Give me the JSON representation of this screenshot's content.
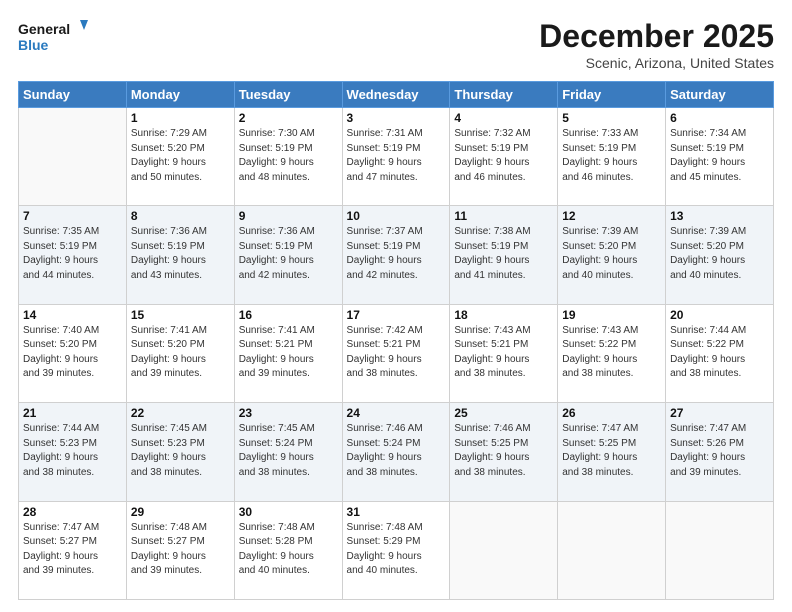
{
  "logo": {
    "line1": "General",
    "line2": "Blue"
  },
  "title": "December 2025",
  "location": "Scenic, Arizona, United States",
  "days_header": [
    "Sunday",
    "Monday",
    "Tuesday",
    "Wednesday",
    "Thursday",
    "Friday",
    "Saturday"
  ],
  "weeks": [
    [
      {
        "num": "",
        "info": ""
      },
      {
        "num": "1",
        "info": "Sunrise: 7:29 AM\nSunset: 5:20 PM\nDaylight: 9 hours\nand 50 minutes."
      },
      {
        "num": "2",
        "info": "Sunrise: 7:30 AM\nSunset: 5:19 PM\nDaylight: 9 hours\nand 48 minutes."
      },
      {
        "num": "3",
        "info": "Sunrise: 7:31 AM\nSunset: 5:19 PM\nDaylight: 9 hours\nand 47 minutes."
      },
      {
        "num": "4",
        "info": "Sunrise: 7:32 AM\nSunset: 5:19 PM\nDaylight: 9 hours\nand 46 minutes."
      },
      {
        "num": "5",
        "info": "Sunrise: 7:33 AM\nSunset: 5:19 PM\nDaylight: 9 hours\nand 46 minutes."
      },
      {
        "num": "6",
        "info": "Sunrise: 7:34 AM\nSunset: 5:19 PM\nDaylight: 9 hours\nand 45 minutes."
      }
    ],
    [
      {
        "num": "7",
        "info": "Sunrise: 7:35 AM\nSunset: 5:19 PM\nDaylight: 9 hours\nand 44 minutes."
      },
      {
        "num": "8",
        "info": "Sunrise: 7:36 AM\nSunset: 5:19 PM\nDaylight: 9 hours\nand 43 minutes."
      },
      {
        "num": "9",
        "info": "Sunrise: 7:36 AM\nSunset: 5:19 PM\nDaylight: 9 hours\nand 42 minutes."
      },
      {
        "num": "10",
        "info": "Sunrise: 7:37 AM\nSunset: 5:19 PM\nDaylight: 9 hours\nand 42 minutes."
      },
      {
        "num": "11",
        "info": "Sunrise: 7:38 AM\nSunset: 5:19 PM\nDaylight: 9 hours\nand 41 minutes."
      },
      {
        "num": "12",
        "info": "Sunrise: 7:39 AM\nSunset: 5:20 PM\nDaylight: 9 hours\nand 40 minutes."
      },
      {
        "num": "13",
        "info": "Sunrise: 7:39 AM\nSunset: 5:20 PM\nDaylight: 9 hours\nand 40 minutes."
      }
    ],
    [
      {
        "num": "14",
        "info": "Sunrise: 7:40 AM\nSunset: 5:20 PM\nDaylight: 9 hours\nand 39 minutes."
      },
      {
        "num": "15",
        "info": "Sunrise: 7:41 AM\nSunset: 5:20 PM\nDaylight: 9 hours\nand 39 minutes."
      },
      {
        "num": "16",
        "info": "Sunrise: 7:41 AM\nSunset: 5:21 PM\nDaylight: 9 hours\nand 39 minutes."
      },
      {
        "num": "17",
        "info": "Sunrise: 7:42 AM\nSunset: 5:21 PM\nDaylight: 9 hours\nand 38 minutes."
      },
      {
        "num": "18",
        "info": "Sunrise: 7:43 AM\nSunset: 5:21 PM\nDaylight: 9 hours\nand 38 minutes."
      },
      {
        "num": "19",
        "info": "Sunrise: 7:43 AM\nSunset: 5:22 PM\nDaylight: 9 hours\nand 38 minutes."
      },
      {
        "num": "20",
        "info": "Sunrise: 7:44 AM\nSunset: 5:22 PM\nDaylight: 9 hours\nand 38 minutes."
      }
    ],
    [
      {
        "num": "21",
        "info": "Sunrise: 7:44 AM\nSunset: 5:23 PM\nDaylight: 9 hours\nand 38 minutes."
      },
      {
        "num": "22",
        "info": "Sunrise: 7:45 AM\nSunset: 5:23 PM\nDaylight: 9 hours\nand 38 minutes."
      },
      {
        "num": "23",
        "info": "Sunrise: 7:45 AM\nSunset: 5:24 PM\nDaylight: 9 hours\nand 38 minutes."
      },
      {
        "num": "24",
        "info": "Sunrise: 7:46 AM\nSunset: 5:24 PM\nDaylight: 9 hours\nand 38 minutes."
      },
      {
        "num": "25",
        "info": "Sunrise: 7:46 AM\nSunset: 5:25 PM\nDaylight: 9 hours\nand 38 minutes."
      },
      {
        "num": "26",
        "info": "Sunrise: 7:47 AM\nSunset: 5:25 PM\nDaylight: 9 hours\nand 38 minutes."
      },
      {
        "num": "27",
        "info": "Sunrise: 7:47 AM\nSunset: 5:26 PM\nDaylight: 9 hours\nand 39 minutes."
      }
    ],
    [
      {
        "num": "28",
        "info": "Sunrise: 7:47 AM\nSunset: 5:27 PM\nDaylight: 9 hours\nand 39 minutes."
      },
      {
        "num": "29",
        "info": "Sunrise: 7:48 AM\nSunset: 5:27 PM\nDaylight: 9 hours\nand 39 minutes."
      },
      {
        "num": "30",
        "info": "Sunrise: 7:48 AM\nSunset: 5:28 PM\nDaylight: 9 hours\nand 40 minutes."
      },
      {
        "num": "31",
        "info": "Sunrise: 7:48 AM\nSunset: 5:29 PM\nDaylight: 9 hours\nand 40 minutes."
      },
      {
        "num": "",
        "info": ""
      },
      {
        "num": "",
        "info": ""
      },
      {
        "num": "",
        "info": ""
      }
    ]
  ]
}
